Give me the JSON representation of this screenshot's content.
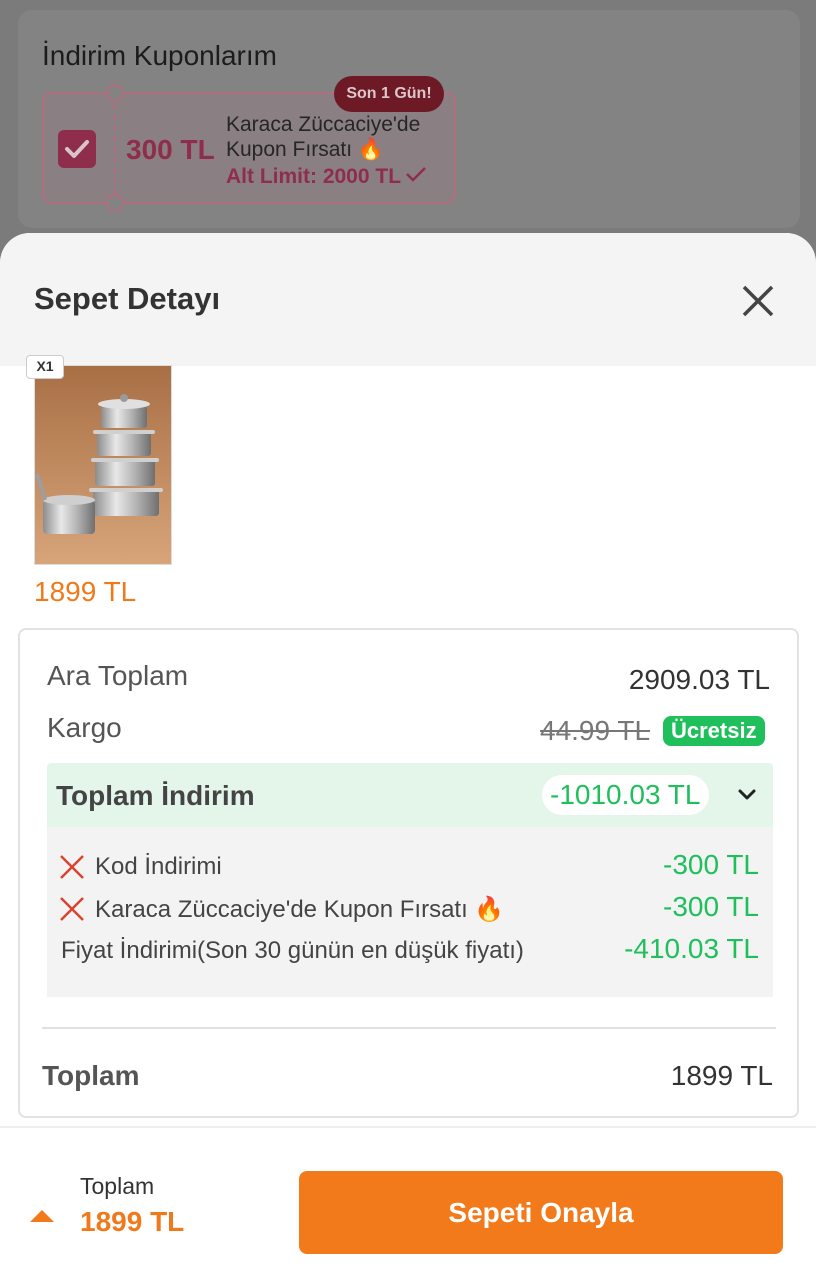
{
  "background": {
    "coupons_title": "İndirim Kuponlarım",
    "coupon": {
      "badge": "Son 1 Gün!",
      "amount": "300 TL",
      "title_line1": "Karaca Züccaciye'de",
      "title_line2": "Kupon Fırsatı 🔥",
      "limit": "Alt Limit: 2000 TL",
      "selected": true
    }
  },
  "sheet": {
    "title": "Sepet Detayı",
    "product": {
      "quantity": "X1",
      "price": "1899 TL"
    },
    "summary": {
      "subtotal_label": "Ara Toplam",
      "subtotal_value": "2909.03 TL",
      "shipping_label": "Kargo",
      "shipping_old": "44.99 TL",
      "shipping_free": "Ücretsiz",
      "discount_label": "Toplam İndirim",
      "discount_value": "-1010.03 TL",
      "discounts": [
        {
          "label": "Kod İndirimi",
          "amount": "-300 TL"
        },
        {
          "label": "Karaca Züccaciye'de Kupon Fırsatı 🔥",
          "amount": "-300 TL"
        },
        {
          "label": "Fiyat İndirimi(Son 30 günün en düşük fiyatı)",
          "amount": "-410.03 TL"
        }
      ],
      "total_label": "Toplam",
      "total_value": "1899 TL"
    }
  },
  "bottom_bar": {
    "total_label": "Toplam",
    "total_value": "1899 TL",
    "confirm_label": "Sepeti Onayla"
  },
  "colors": {
    "accent": "#f27a1a",
    "success": "#1fbf5c",
    "coupon": "#8e2e4c"
  }
}
